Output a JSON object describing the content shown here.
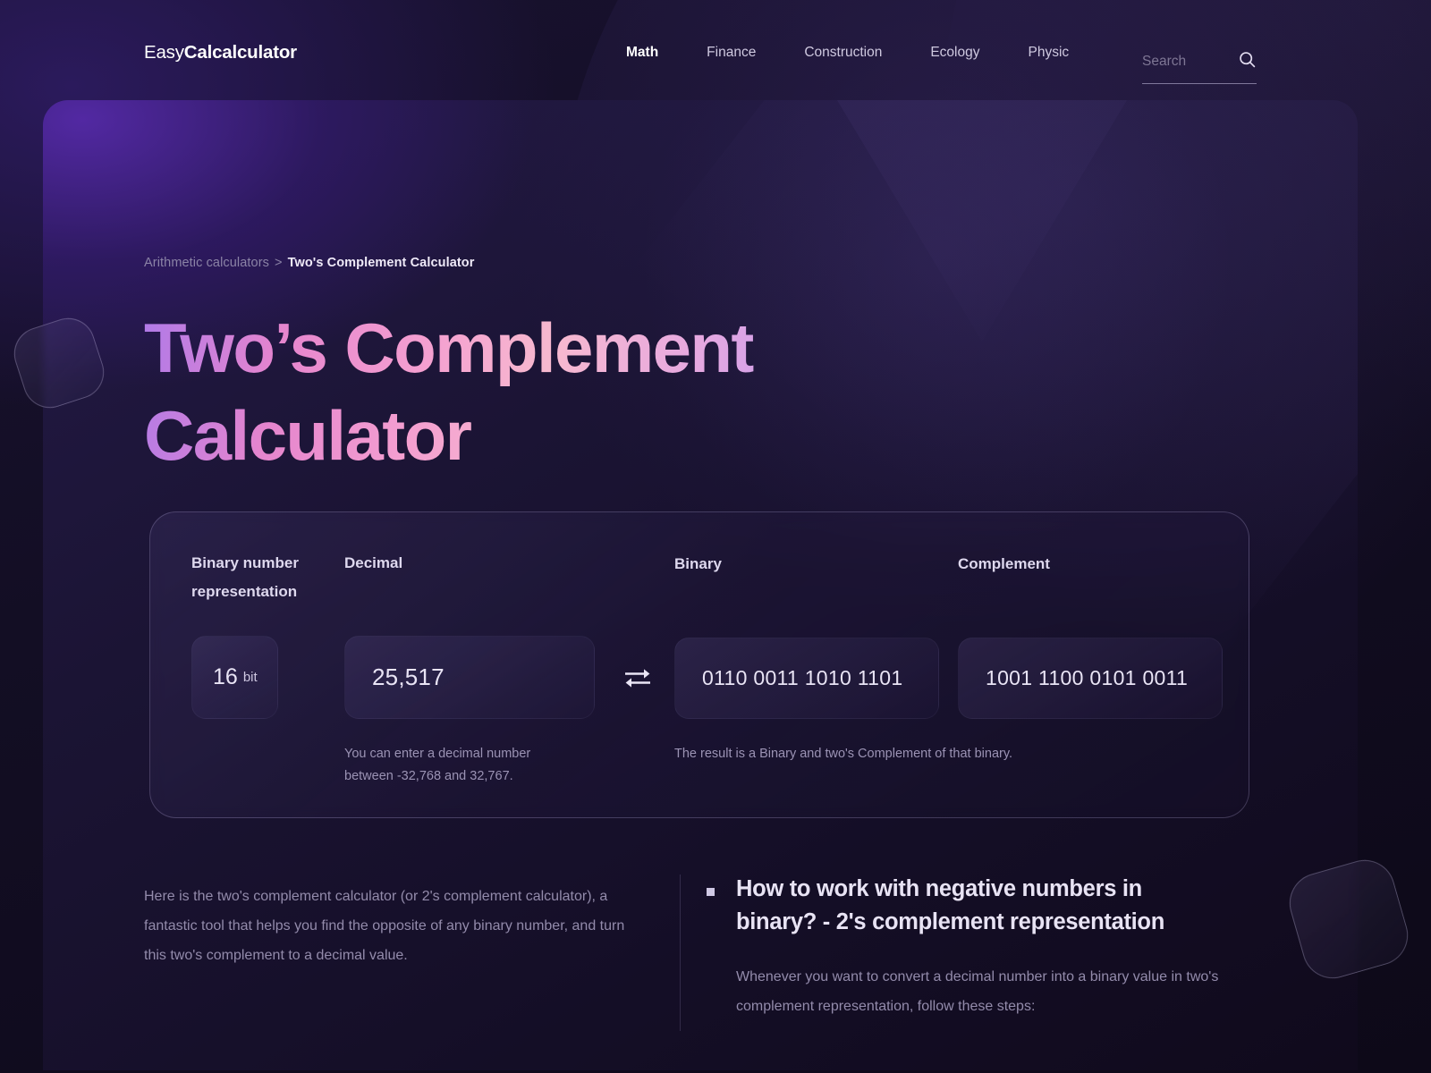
{
  "header": {
    "logo_light": "Easy",
    "logo_bold": "Calcalculator",
    "nav": [
      {
        "label": "Math",
        "active": true
      },
      {
        "label": "Finance",
        "active": false
      },
      {
        "label": "Construction",
        "active": false
      },
      {
        "label": "Ecology",
        "active": false
      },
      {
        "label": "Physic",
        "active": false
      }
    ],
    "search": {
      "placeholder": "Search",
      "value": "",
      "icon": "search-icon"
    }
  },
  "breadcrumb": {
    "parent": "Arithmetic calculators",
    "separator": ">",
    "current": "Two's Complement Calculator"
  },
  "page_title": "Two’s Complement Calculator",
  "calculator": {
    "labels": {
      "bit_representation": "Binary number representation",
      "decimal": "Decimal",
      "binary": "Binary",
      "complement": "Complement"
    },
    "bits": {
      "value": "16",
      "unit": "bit"
    },
    "decimal_value": "25,517",
    "binary_value": "0110 0011 1010 1101",
    "complement_value": "1001 1100 0101 0011",
    "swap_icon": "swap-arrows-icon",
    "hints": {
      "decimal": "You can enter a decimal number between -32,768 and 32,767.",
      "binary": "The result is a Binary and two's Complement of that binary."
    }
  },
  "content": {
    "intro_paragraph": "Here is the two's complement calculator (or 2's complement calculator), a fantastic tool that helps you find the opposite of any binary number, and turn this two's complement to a decimal value.",
    "section_heading": "How to work with negative numbers in binary? - 2's complement representation",
    "section_paragraph": "Whenever you want to convert a decimal number into a binary value in two's complement representation, follow these steps:"
  },
  "colors": {
    "accent_purple": "#7a4fd0",
    "title_gradient_start": "#b07ae8",
    "title_gradient_mid": "#f49fd0",
    "title_gradient_end": "#b287ec",
    "panel_bg": "#1b1434",
    "page_bg": "#0f0a1a"
  }
}
